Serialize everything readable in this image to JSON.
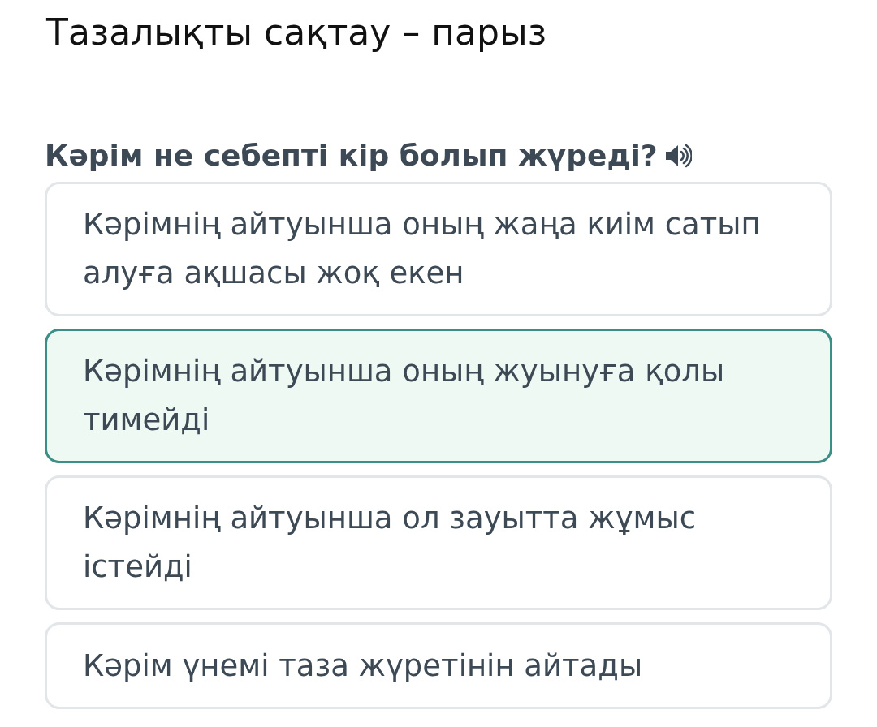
{
  "title": "Тазалықты сақтау – парыз",
  "question": {
    "text": "Кәрім не себепті кір болып жүреді?"
  },
  "options": [
    {
      "text": "Кәрімнің айтуынша оның жаңа киім сатып алуға ақшасы жоқ екен",
      "selected": false
    },
    {
      "text": "Кәрімнің айтуынша оның жуынуға қолы тимейді",
      "selected": true
    },
    {
      "text": "Кәрімнің айтуынша ол зауытта жұмыс істейді",
      "selected": false
    },
    {
      "text": "Кәрім үнемі таза жүретінін айтады",
      "selected": false
    }
  ]
}
